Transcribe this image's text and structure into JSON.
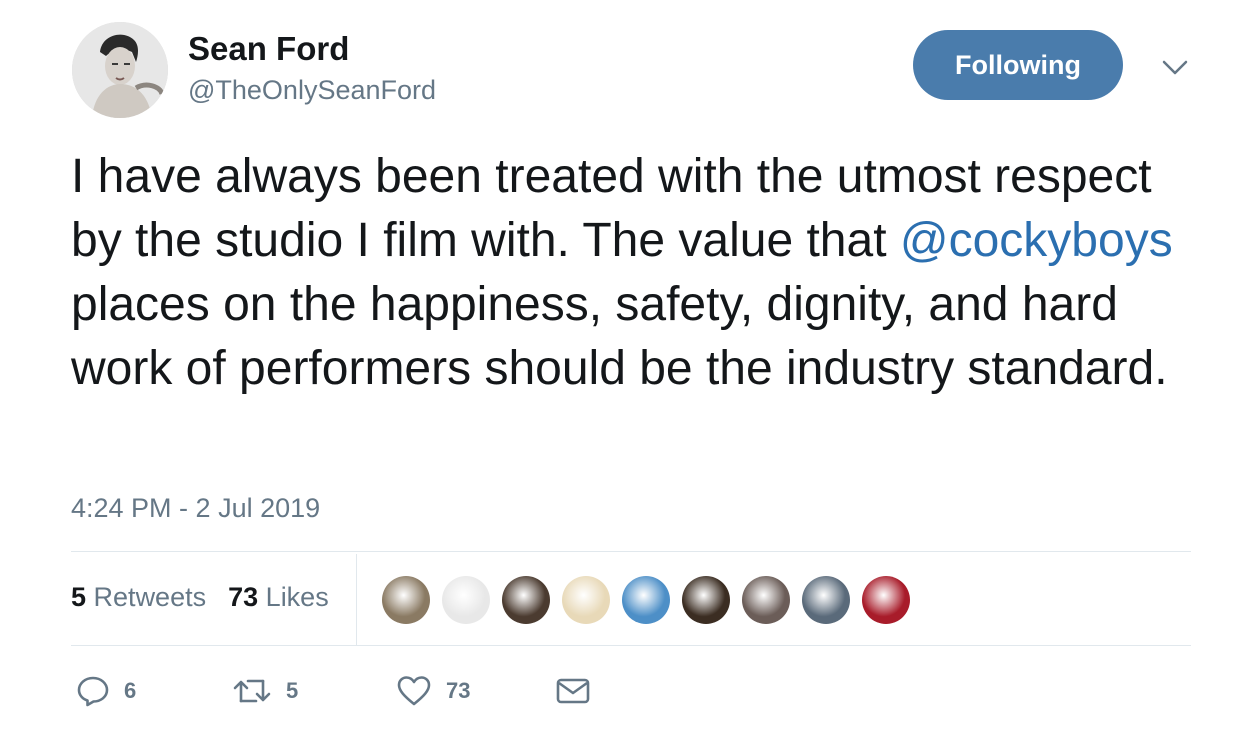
{
  "author": {
    "display_name": "Sean Ford",
    "handle": "@TheOnlySeanFord"
  },
  "follow_button": {
    "label": "Following"
  },
  "tweet": {
    "text_before": "I have always been treated with the utmost respect by the studio I film with. The value that ",
    "mention": "@cockyboys",
    "text_after": " places on the happiness, safety, dignity, and hard work of performers should be the industry standard.",
    "timestamp": "4:24 PM - 2 Jul 2019"
  },
  "stats": {
    "retweets_count": "5",
    "retweets_label": "Retweets",
    "likes_count": "73",
    "likes_label": "Likes"
  },
  "liker_avatar_colors": [
    "#8a7a63",
    "#e8e8e8",
    "#4b3b30",
    "#e8d9b8",
    "#4d8fc7",
    "#3b2d22",
    "#6b5d58",
    "#5a6a7a",
    "#a81c2a"
  ],
  "actions": {
    "reply_count": "6",
    "retweet_count": "5",
    "like_count": "73"
  },
  "colors": {
    "follow_button": "#4a7cac",
    "link": "#2b6fb0",
    "secondary_text": "#657786"
  },
  "icons": [
    "chevron-down-icon",
    "reply-icon",
    "retweet-icon",
    "heart-icon",
    "mail-icon"
  ]
}
